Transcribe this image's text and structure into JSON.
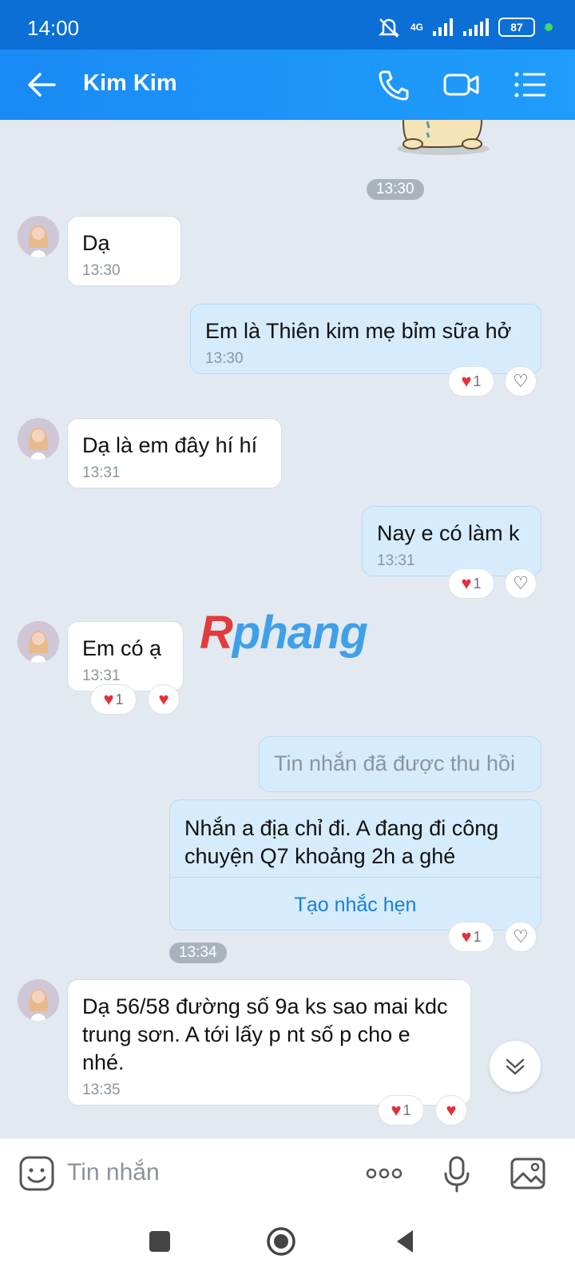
{
  "status_bar": {
    "time": "14:00",
    "network": "4G",
    "battery": "87"
  },
  "header": {
    "contact_name": "Kim Kim"
  },
  "messages": [
    {
      "time_pill": "13:30"
    },
    {
      "text": "Dạ",
      "time": "13:30"
    },
    {
      "text": "Em là Thiên kim mẹ bỉm sữa hở",
      "time": "13:30",
      "reaction_count": "1"
    },
    {
      "text": "Dạ là em đây hí hí",
      "time": "13:31"
    },
    {
      "text": "Nay e có làm k",
      "time": "13:31",
      "reaction_count": "1"
    },
    {
      "text": "Em có ạ",
      "time": "13:31",
      "reaction_count": "1"
    },
    {
      "text": "Tin nhắn đã được thu hồi"
    },
    {
      "text": "Nhắn a địa chỉ đi. A đang đi công chuyện Q7 khoảng 2h a ghé",
      "reminder_label": "Tạo nhắc hẹn",
      "reaction_count": "1"
    },
    {
      "time_pill": "13:34"
    },
    {
      "text": "Dạ 56/58 đường số 9a ks sao mai kdc trung sơn. A tới lấy p nt số p cho e nhé.",
      "time": "13:35",
      "reaction_count": "1"
    }
  ],
  "watermark": {
    "first": "R",
    "rest": "phang"
  },
  "input": {
    "placeholder": "Tin nhắn"
  }
}
